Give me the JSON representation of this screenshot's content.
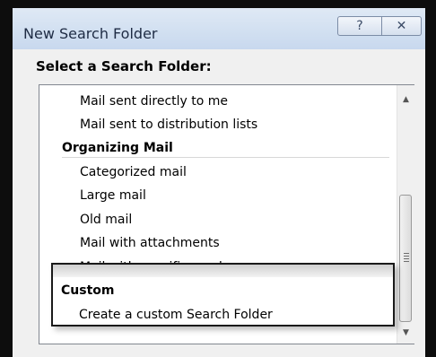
{
  "dialog": {
    "title": "New Search Folder",
    "help_button": "?",
    "close_button": "✕",
    "heading": "Select a Search Folder:"
  },
  "list": {
    "items": [
      {
        "type": "item",
        "label": "Mail sent directly to me"
      },
      {
        "type": "item",
        "label": "Mail sent to distribution lists"
      },
      {
        "type": "group",
        "label": "Organizing Mail"
      },
      {
        "type": "item",
        "label": "Categorized mail"
      },
      {
        "type": "item",
        "label": "Large mail"
      },
      {
        "type": "item",
        "label": "Old mail"
      },
      {
        "type": "item",
        "label": "Mail with attachments"
      },
      {
        "type": "item",
        "label": "Mail with specific words"
      },
      {
        "type": "group",
        "label": "Custom"
      },
      {
        "type": "item",
        "label": "Create a custom Search Folder"
      }
    ],
    "highlighted_group": "Custom"
  },
  "scrollbar": {
    "up_arrow": "▲",
    "down_arrow": "▼"
  }
}
